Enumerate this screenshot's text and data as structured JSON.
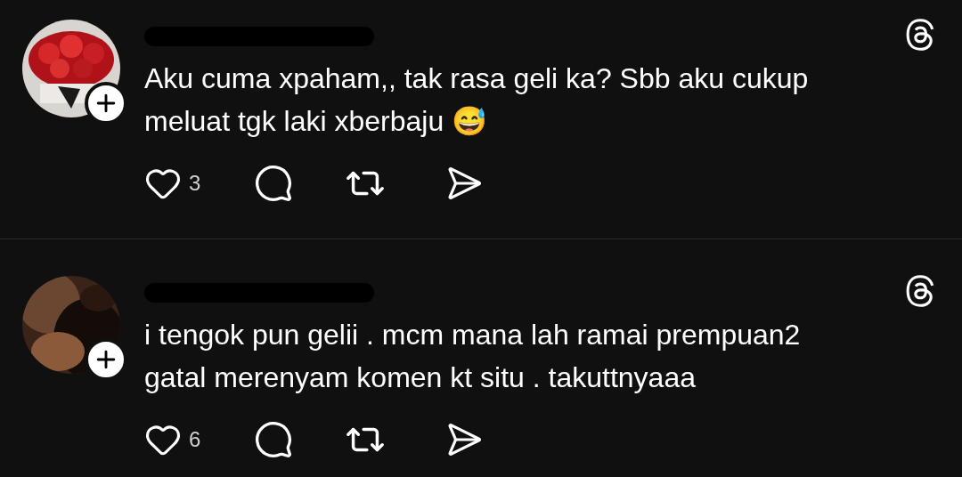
{
  "posts": [
    {
      "text": "Aku cuma xpaham,, tak rasa geli ka? Sbb aku cukup meluat tgk laki xberbaju 😅",
      "likes": "3"
    },
    {
      "text": "i tengok pun gelii . mcm mana lah ramai prempuan2 gatal merenyam komen kt situ . takuttnyaaa",
      "likes": "6"
    }
  ]
}
